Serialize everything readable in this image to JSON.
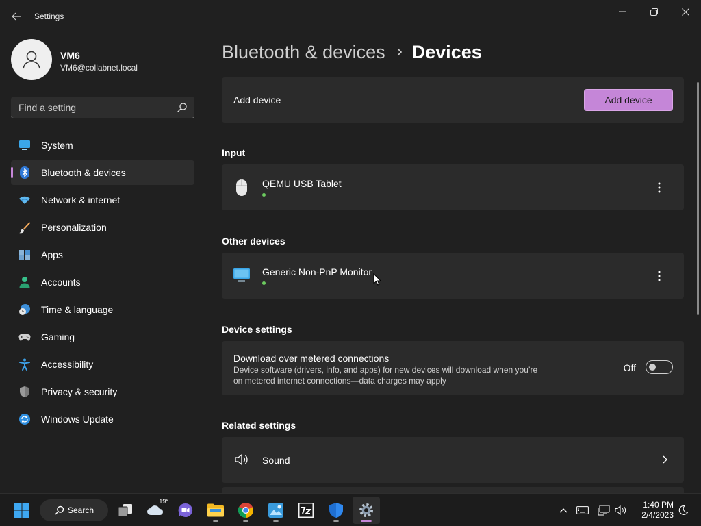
{
  "window": {
    "title": "Settings"
  },
  "user": {
    "name": "VM6",
    "email": "VM6@collabnet.local"
  },
  "search": {
    "placeholder": "Find a setting"
  },
  "sidebar": {
    "items": [
      {
        "label": "System",
        "icon": "monitor-icon"
      },
      {
        "label": "Bluetooth & devices",
        "icon": "bluetooth-icon",
        "selected": true
      },
      {
        "label": "Network & internet",
        "icon": "wifi-icon"
      },
      {
        "label": "Personalization",
        "icon": "brush-icon"
      },
      {
        "label": "Apps",
        "icon": "apps-icon"
      },
      {
        "label": "Accounts",
        "icon": "person-icon"
      },
      {
        "label": "Time & language",
        "icon": "clock-globe-icon"
      },
      {
        "label": "Gaming",
        "icon": "gamepad-icon"
      },
      {
        "label": "Accessibility",
        "icon": "accessibility-icon"
      },
      {
        "label": "Privacy & security",
        "icon": "shield-icon"
      },
      {
        "label": "Windows Update",
        "icon": "update-icon"
      }
    ]
  },
  "breadcrumb": {
    "parent": "Bluetooth & devices",
    "current": "Devices"
  },
  "add_device": {
    "label": "Add device",
    "button": "Add device"
  },
  "input_section": {
    "title": "Input",
    "devices": [
      {
        "name": "QEMU USB Tablet",
        "icon": "mouse-icon",
        "status": "connected"
      }
    ]
  },
  "other_section": {
    "title": "Other devices",
    "devices": [
      {
        "name": "Generic Non-PnP Monitor",
        "icon": "monitor-icon",
        "status": "connected"
      }
    ]
  },
  "device_settings": {
    "title": "Device settings",
    "metered": {
      "label": "Download over metered connections",
      "desc_line1": "Device software (drivers, info, and apps) for new devices will download when you’re",
      "desc_line2": "on metered internet connections—data charges may apply",
      "state": "Off",
      "on": false
    }
  },
  "related": {
    "title": "Related settings",
    "items": [
      {
        "label": "Sound",
        "icon": "speaker-icon"
      }
    ]
  },
  "taskbar": {
    "search_label": "Search",
    "weather_temp": "19°",
    "time": "1:40 PM",
    "date": "2/4/2023"
  },
  "colors": {
    "accent": "#c586d8",
    "background": "#202020",
    "card": "#2b2b2b",
    "connected": "#6ccb5f"
  }
}
